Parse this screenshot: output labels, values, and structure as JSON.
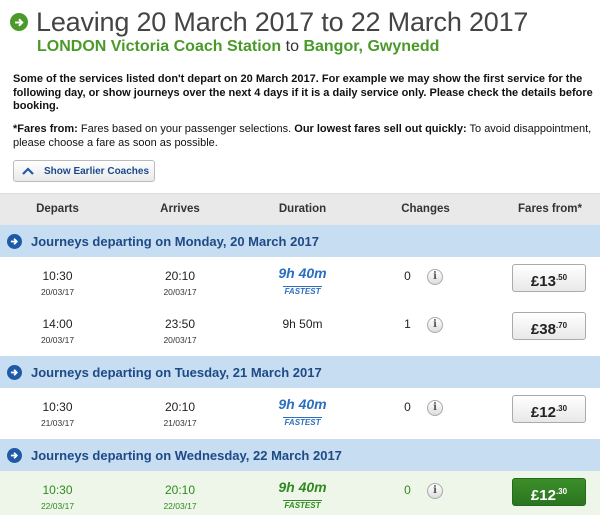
{
  "header": {
    "title": "Leaving 20 March 2017 to 22 March 2017",
    "origin": "LONDON Victoria Coach Station",
    "to_word": "to",
    "destination": "Bangor, Gwynedd"
  },
  "notice": "Some of the services listed don't depart on 20 March 2017. For example we may show the first service for the following day, or show journeys over the next 4 days if it is a daily service only. Please check the details before booking.",
  "fares_note": {
    "label": "*Fares from:",
    "text1": " Fares based on your passenger selections. ",
    "bold2": "Our lowest fares sell out quickly:",
    "text2": " To avoid disappointment, please choose a fare as soon as possible."
  },
  "earlier_button": "Show Earlier Coaches",
  "columns": {
    "departs": "Departs",
    "arrives": "Arrives",
    "duration": "Duration",
    "changes": "Changes",
    "fares": "Fares from*"
  },
  "days": [
    {
      "label": "Journeys departing on Monday, 20 March 2017"
    },
    {
      "label": "Journeys departing on Tuesday, 21 March 2017"
    },
    {
      "label": "Journeys departing on Wednesday, 22 March 2017"
    }
  ],
  "journeys": [
    {
      "dep_time": "10:30",
      "dep_date": "20/03/17",
      "arr_time": "20:10",
      "arr_date": "20/03/17",
      "duration": "9h 40m",
      "fastest": "FASTEST",
      "changes": "0",
      "fare_main": "£13",
      "fare_pence": ".50"
    },
    {
      "dep_time": "14:00",
      "dep_date": "20/03/17",
      "arr_time": "23:50",
      "arr_date": "20/03/17",
      "duration": "9h 50m",
      "changes": "1",
      "fare_main": "£38",
      "fare_pence": ".70"
    },
    {
      "dep_time": "10:30",
      "dep_date": "21/03/17",
      "arr_time": "20:10",
      "arr_date": "21/03/17",
      "duration": "9h 40m",
      "fastest": "FASTEST",
      "changes": "0",
      "fare_main": "£12",
      "fare_pence": ".30"
    },
    {
      "dep_time": "10:30",
      "dep_date": "22/03/17",
      "arr_time": "20:10",
      "arr_date": "22/03/17",
      "duration": "9h 40m",
      "fastest": "FASTEST",
      "changes": "0",
      "fare_main": "£12",
      "fare_pence": ".30",
      "selected": true
    }
  ],
  "info_glyph": "i",
  "colors": {
    "green": "#4a9a2a",
    "blue": "#1f5aa6",
    "day_bar": "#c6ddf2",
    "selected_fare": "#2f8a1f"
  }
}
